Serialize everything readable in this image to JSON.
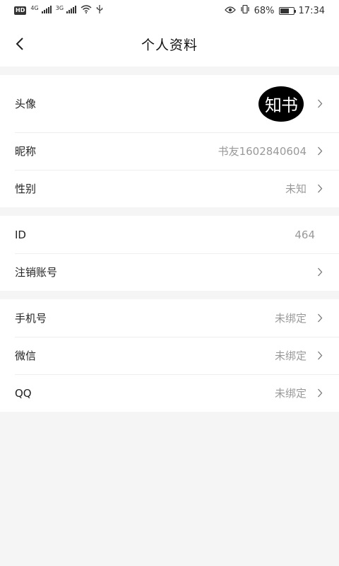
{
  "status_bar": {
    "hd": "HD",
    "net1": "4G",
    "net2": "3G",
    "battery_pct": "68%",
    "time": "17:34"
  },
  "header": {
    "title": "个人资料"
  },
  "profile": {
    "avatar_label": "头像",
    "avatar_text": "知书",
    "nickname_label": "昵称",
    "nickname_value": "书友1602840604",
    "gender_label": "性别",
    "gender_value": "未知"
  },
  "account": {
    "id_label": "ID",
    "id_value": "464",
    "deregister_label": "注销账号"
  },
  "binding": {
    "phone_label": "手机号",
    "phone_value": "未绑定",
    "wechat_label": "微信",
    "wechat_value": "未绑定",
    "qq_label": "QQ",
    "qq_value": "未绑定"
  },
  "colors": {
    "background": "#f5f5f5",
    "card": "#ffffff",
    "secondary_text": "#999999"
  }
}
